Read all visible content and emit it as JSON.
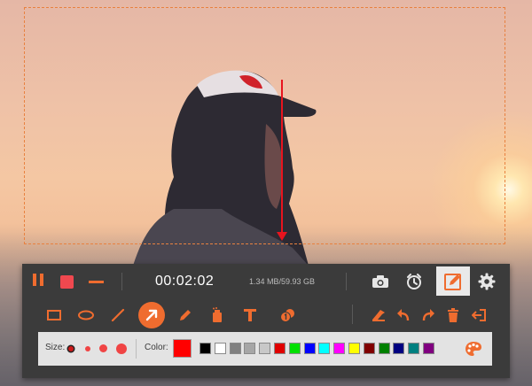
{
  "recorder": {
    "timer": "00:02:02",
    "file_size": "1.34 MB/59.93 GB"
  },
  "palette": {
    "size_label": "Size:",
    "color_label": "Color:",
    "current_color": "#ff0000",
    "swatches": [
      "#000000",
      "#ffffff",
      "#808080",
      "#a6a6a6",
      "#c8c8c8",
      "#e00000",
      "#00e000",
      "#0000ff",
      "#00ffff",
      "#ff00ff",
      "#ffff00",
      "#800000",
      "#008000",
      "#000080",
      "#008080",
      "#800080"
    ]
  },
  "colors": {
    "accent": "#ef6c2f",
    "toolbar_bg": "#3b3b3b",
    "selection_border": "#e8813f"
  }
}
